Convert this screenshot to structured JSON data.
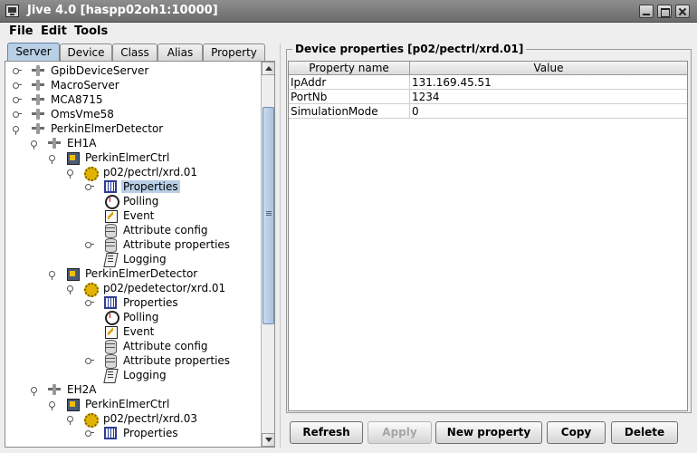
{
  "window": {
    "title": "Jive 4.0  [haspp02oh1:10000]"
  },
  "menu": {
    "items": [
      "File",
      "Edit",
      "Tools"
    ]
  },
  "tabs": [
    "Server",
    "Device",
    "Class",
    "Alias",
    "Property"
  ],
  "tree": {
    "nodes": [
      "GpibDeviceServer",
      "MacroServer",
      "MCA8715",
      "OmsVme58",
      "PerkinElmerDetector",
      "EH1A",
      "PerkinElmerCtrl",
      "p02/pectrl/xrd.01",
      "Properties",
      "Polling",
      "Event",
      "Attribute config",
      "Attribute properties",
      "Logging",
      "PerkinElmerDetector",
      "p02/pedetector/xrd.01",
      "Properties",
      "Polling",
      "Event",
      "Attribute config",
      "Attribute properties",
      "Logging",
      "EH2A",
      "PerkinElmerCtrl",
      "p02/pectrl/xrd.03",
      "Properties"
    ]
  },
  "properties_panel": {
    "title": "Device properties [p02/pectrl/xrd.01]",
    "columns": [
      "Property name",
      "Value"
    ],
    "rows": [
      {
        "name": "IpAddr",
        "value": "131.169.45.51"
      },
      {
        "name": "PortNb",
        "value": "1234"
      },
      {
        "name": "SimulationMode",
        "value": "0"
      }
    ]
  },
  "buttons": {
    "refresh": "Refresh",
    "apply": "Apply",
    "new_property": "New property",
    "copy": "Copy",
    "delete": "Delete"
  }
}
